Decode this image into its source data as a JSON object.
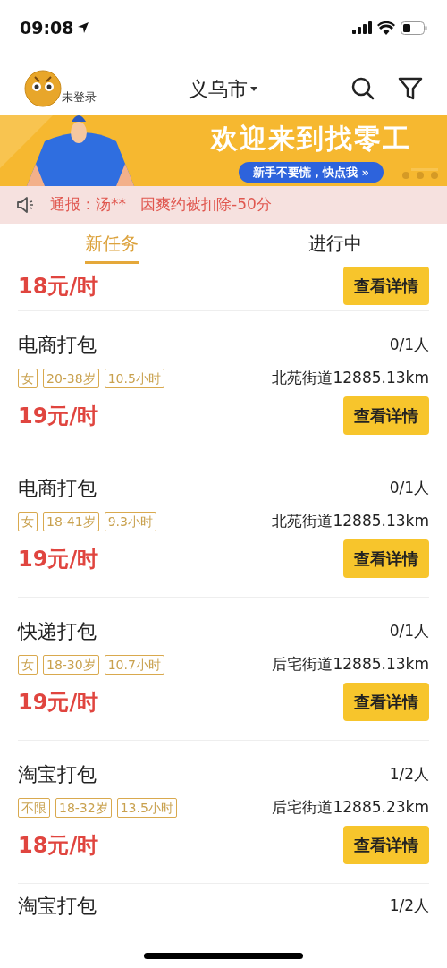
{
  "status_bar": {
    "time": "09:08"
  },
  "header": {
    "login_label": "未登录",
    "city": "义乌市"
  },
  "banner": {
    "title": "欢迎来到找零工",
    "button": "新手不要慌，快点我 »"
  },
  "notice": {
    "label": "通报：汤**",
    "message": "因爽约被扣除-50分"
  },
  "tabs": [
    {
      "label": "新任务",
      "selected": true
    },
    {
      "label": "进行中",
      "selected": false
    }
  ],
  "jobs": [
    {
      "kind": "partial_top",
      "price": "18元/时",
      "button": "查看详情"
    },
    {
      "kind": "full",
      "title": "电商打包",
      "count": "0/1人",
      "tags": [
        "女",
        "20-38岁",
        "10.5小时"
      ],
      "location": "北苑街道12885.13km",
      "price": "19元/时",
      "button": "查看详情"
    },
    {
      "kind": "full",
      "title": "电商打包",
      "count": "0/1人",
      "tags": [
        "女",
        "18-41岁",
        "9.3小时"
      ],
      "location": "北苑街道12885.13km",
      "price": "19元/时",
      "button": "查看详情"
    },
    {
      "kind": "full",
      "title": "快递打包",
      "count": "0/1人",
      "tags": [
        "女",
        "18-30岁",
        "10.7小时"
      ],
      "location": "后宅街道12885.13km",
      "price": "19元/时",
      "button": "查看详情"
    },
    {
      "kind": "full",
      "title": "淘宝打包",
      "count": "1/2人",
      "tags": [
        "不限",
        "18-32岁",
        "13.5小时"
      ],
      "location": "后宅街道12885.23km",
      "price": "18元/时",
      "button": "查看详情"
    },
    {
      "kind": "partial_bottom",
      "title": "淘宝打包",
      "count": "1/2人"
    }
  ]
}
